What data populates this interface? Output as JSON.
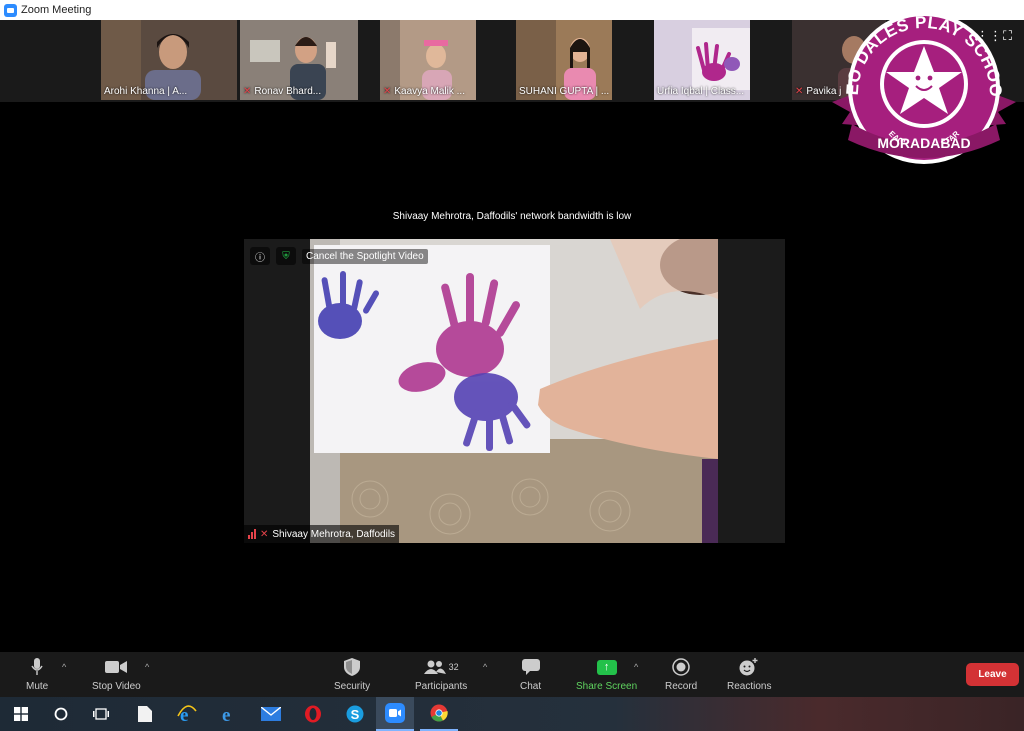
{
  "window": {
    "title": "Zoom Meeting"
  },
  "gallery": [
    {
      "name": "Arohi Khanna | A...",
      "muted": false,
      "bg": "#5a4a40"
    },
    {
      "name": "Ronav Bhard...",
      "muted": true,
      "bg": "#8a8078"
    },
    {
      "name": "Kaavya Malik ...",
      "muted": true,
      "bg": "#b39a86"
    },
    {
      "name": "SUHANI GUPTA | ...",
      "muted": false,
      "bg": "#7a6048"
    },
    {
      "name": "Urfia Iqbal | Class...",
      "muted": false,
      "bg": "#d8cfe0"
    },
    {
      "name": "Pavika j",
      "muted": true,
      "bg": "#3a3030"
    }
  ],
  "logo": {
    "top_text": "NEO DALES PLAY SCHOOL",
    "tagline": "EACH CHILD A STAR",
    "city": "MORADABAD",
    "color": "#a61f7e"
  },
  "notice": "Shivaay Mehrotra, Daffodils' network bandwidth is low",
  "spotlight": {
    "cancel_label": "Cancel the Spotlight Video",
    "participant": "Shivaay Mehrotra, Daffodils"
  },
  "toolbar": {
    "mute": "Mute",
    "stop_video": "Stop Video",
    "security": "Security",
    "participants": "Participants",
    "participant_count": "32",
    "chat": "Chat",
    "share_screen": "Share Screen",
    "record": "Record",
    "reactions": "Reactions",
    "leave": "Leave"
  },
  "colors": {
    "accent": "#2d8cff",
    "leave": "#d33235",
    "share": "#23c14a",
    "muted": "#e5434a"
  }
}
